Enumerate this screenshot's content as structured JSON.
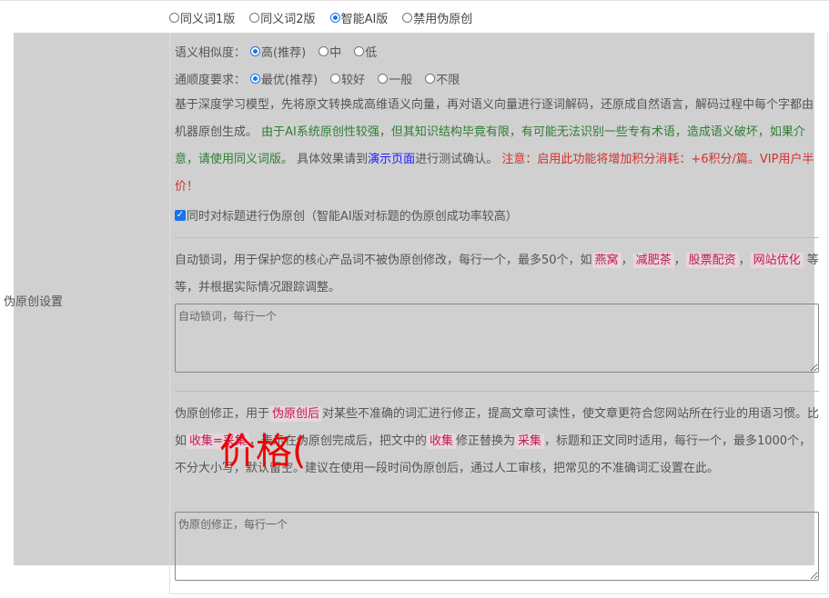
{
  "mode_options": [
    {
      "label": "同义词1版",
      "checked": false
    },
    {
      "label": "同义词2版",
      "checked": false
    },
    {
      "label": "智能AI版",
      "checked": true
    },
    {
      "label": "禁用伪原创",
      "checked": false
    }
  ],
  "row_label": "伪原创设置",
  "similarity": {
    "label": "语义相似度：",
    "options": [
      {
        "label": "高(推荐)",
        "checked": true
      },
      {
        "label": "中",
        "checked": false
      },
      {
        "label": "低",
        "checked": false
      }
    ]
  },
  "fluency": {
    "label": "通顺度要求：",
    "options": [
      {
        "label": "最优(推荐)",
        "checked": true
      },
      {
        "label": "较好",
        "checked": false
      },
      {
        "label": "一般",
        "checked": false
      },
      {
        "label": "不限",
        "checked": false
      }
    ]
  },
  "ai_desc": {
    "intro": "基于深度学习模型，先将原文转换成高维语义向量，再对语义向量进行逐词解码，还原成自然语言，解码过程中每个字都由机器原创生成。",
    "warning_green": "由于AI系统原创性较强，但其知识结构毕竟有限，有可能无法识别一些专有术语，造成语义破坏，如果介意，请使用同义词版。",
    "effect_prefix": "具体效果请到",
    "demo_link": "演示页面",
    "effect_suffix": "进行测试确认。",
    "notice_red": "注意：启用此功能将增加积分消耗：+6积分/篇。VIP用户半价！"
  },
  "title_checkbox": {
    "label": "同时对标题进行伪原创（智能AI版对标题的伪原创成功率较高）",
    "checked": true
  },
  "lock_words": {
    "desc_prefix": "自动锁词，用于保护您的核心产品词不被伪原创修改，每行一个，最多50个，如",
    "examples": [
      "燕窝",
      "减肥茶",
      "股票配资",
      "网站优化"
    ],
    "separator": "，",
    "desc_suffix": "等等，并根据实际情况跟踪调整。",
    "placeholder": "自动锁词，每行一个"
  },
  "corrections": {
    "text_1": "伪原创修正，用于",
    "tag_1": "伪原创后",
    "text_2": "对某些不准确的词汇进行修正，提高文章可读性，使文章更符合您网站所在行业的用语习惯。比如",
    "tag_2": "收集=采集",
    "text_3": "，表示在伪原创完成后，把文中的",
    "tag_3": "收集",
    "text_4": "修正替换为",
    "tag_4": "采集",
    "text_5": "，标题和正文同时适用，每行一个，最多1000个，不分大小写，默认留空。建议在使用一段时间伪原创后，通过人工审核，把常见的不准确词汇设置在此。",
    "placeholder": "伪原创修正，每行一个"
  },
  "overlay": "价格(",
  "colors": {
    "accent": "#1a73e8",
    "green": "#2e7d32",
    "red": "#d32f2f",
    "link": "#1a1aff",
    "panel": "#d0d0d0"
  }
}
